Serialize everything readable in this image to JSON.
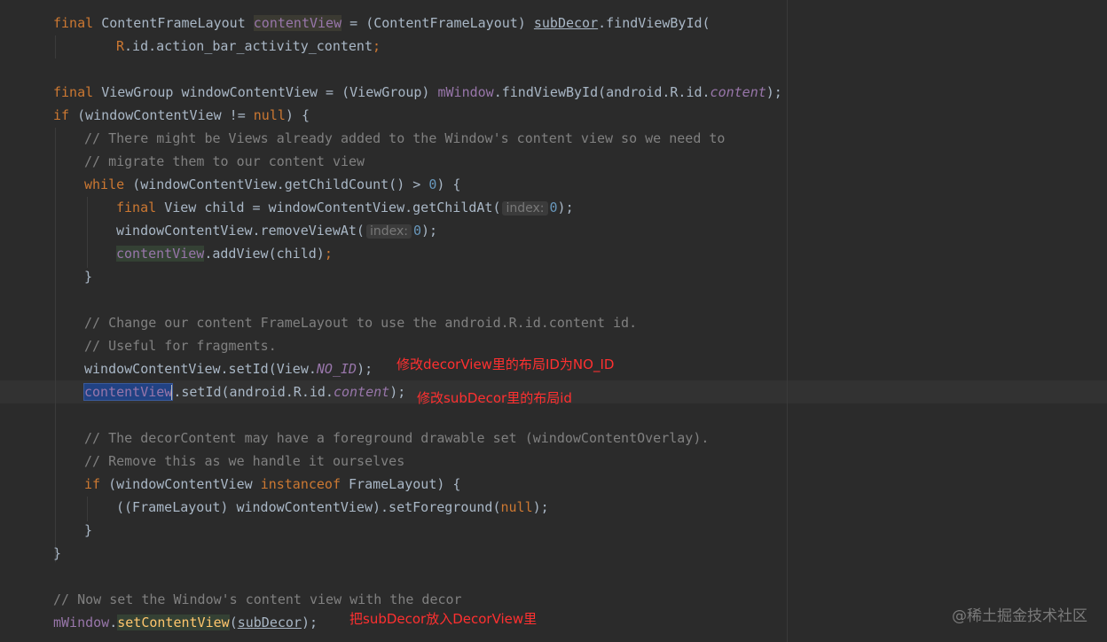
{
  "code": {
    "l1": {
      "a": "final ",
      "b": "ContentFrameLayout ",
      "c": "contentView",
      "d": " = (ContentFrameLayout) ",
      "e": "subDecor",
      ".": ".",
      "f": "findViewById("
    },
    "l2": {
      "a": "R",
      ".": ".id.action_bar_activity_content",
      ";": ";"
    },
    "l4": {
      "a": "final ",
      "b": "ViewGroup windowContentView = (ViewGroup) ",
      "c": "mWindow",
      "d": ".findViewById(android.R.id.",
      "e": "content",
      "f": ");"
    },
    "l5": {
      "a": "if ",
      "b": "(windowContentView != ",
      "c": "null",
      "d": ") {"
    },
    "l6": "// There might be Views already added to the Window's content view so we need to",
    "l7": "// migrate them to our content view",
    "l8": {
      "a": "while ",
      "b": "(windowContentView.getChildCount() > ",
      "c": "0",
      "d": ") {"
    },
    "l9": {
      "a": "final ",
      "b": "View child = windowContentView.getChildAt(",
      "hint": "index:",
      "c": "0",
      "d": ");"
    },
    "l10": {
      "a": "windowContentView.removeViewAt(",
      "hint": "index:",
      "c": "0",
      "d": ");"
    },
    "l11": {
      "a": "contentView",
      "b": ".addView(child)",
      "c": ";"
    },
    "l12": "}",
    "l14": "// Change our content FrameLayout to use the android.R.id.content id.",
    "l15": "// Useful for fragments.",
    "l16": {
      "a": "windowContentView.setId(View.",
      "b": "NO_ID",
      "c": ");"
    },
    "l17": {
      "a": "contentView",
      ".": ".setId(android.R.id.",
      "b": "content",
      "c": ");"
    },
    "l19": "// The decorContent may have a foreground drawable set (windowContentOverlay).",
    "l20": "// Remove this as we handle it ourselves",
    "l21": {
      "a": "if ",
      "b": "(windowContentView ",
      "c": "instanceof ",
      "d": "FrameLayout) {"
    },
    "l22": {
      "a": "((FrameLayout) windowContentView).setForeground(",
      "b": "null",
      "c": ");"
    },
    "l23": "}",
    "l24": "}",
    "l26": "// Now set the Window's content view with the decor",
    "l27": {
      "a": "mWindow",
      ".": ".",
      "b": "setContentView",
      "c": "(",
      "d": "subDecor",
      "e": ");"
    }
  },
  "annotations": {
    "a1": "修改decorView里的布局ID为NO_ID",
    "a2": "修改subDecor里的布局id",
    "a3": "把subDecor放入DecorView里"
  },
  "watermark": "@稀土掘金技术社区"
}
